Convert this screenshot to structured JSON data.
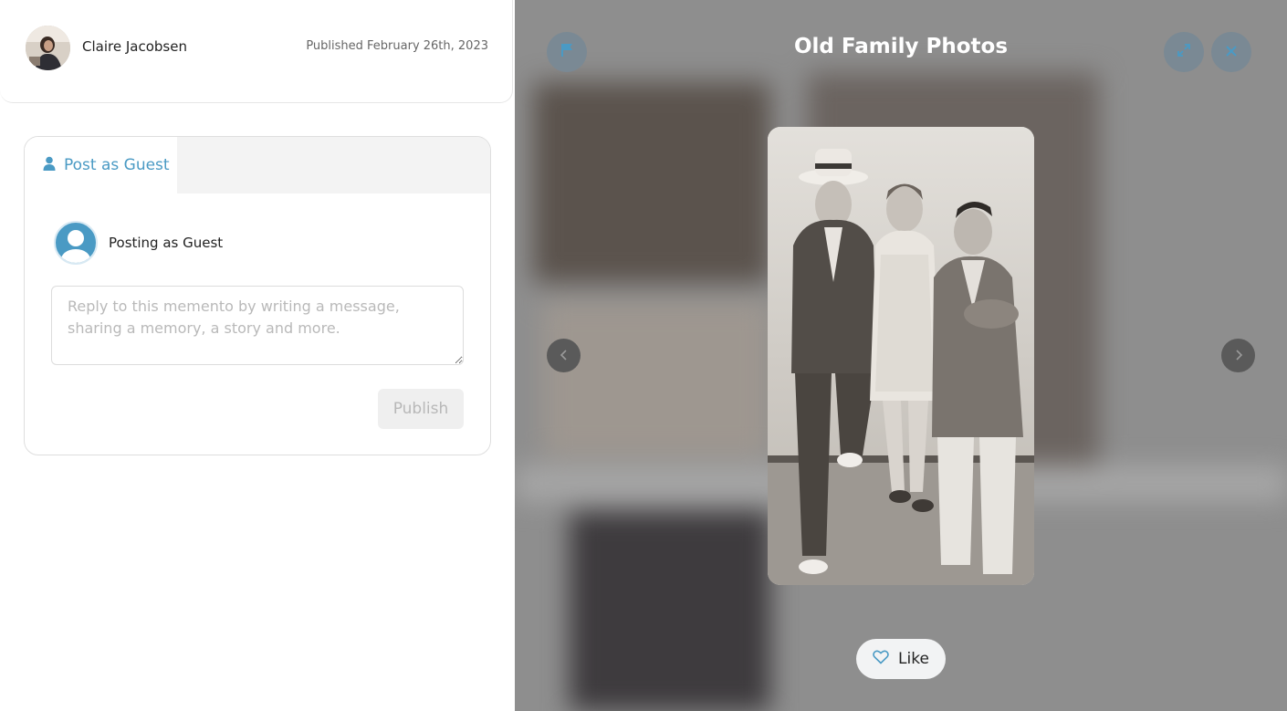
{
  "author": {
    "name": "Claire Jacobsen",
    "published": "Published February 26th, 2023"
  },
  "comment": {
    "tab_label": "Post as Guest",
    "guest_label": "Posting as Guest",
    "reply_placeholder": "Reply to this memento by writing a message, sharing a memory, a story and more.",
    "reply_value": "",
    "publish_label": "Publish"
  },
  "viewer": {
    "title": "Old Family Photos",
    "like_label": "Like"
  },
  "icons": {
    "flag": "flag-icon",
    "expand": "expand-icon",
    "close": "close-icon",
    "prev": "chevron-left-icon",
    "next": "chevron-right-icon",
    "heart": "heart-icon",
    "user": "user-icon"
  },
  "colors": {
    "accent": "#4a9ac4",
    "overlay": "#8e8e8e"
  }
}
